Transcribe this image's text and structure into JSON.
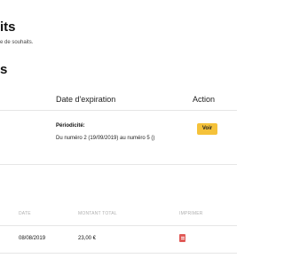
{
  "header": {
    "title": "its",
    "subtitle": "e de souhaits."
  },
  "section": {
    "heading": "s"
  },
  "subscription_table": {
    "col_expiry": "Date d'expiration",
    "col_action": "Action",
    "row": {
      "periodicity_label": "Périodicité:",
      "periodicity_range": "Du numéro 2 (19/09/2019) au numéro 5 ()",
      "action_label": "Voir"
    }
  },
  "orders_table": {
    "col_date": "DATE",
    "col_amount": "MONTANT TOTAL",
    "col_print": "IMPRIMER",
    "rows": [
      {
        "date": "08/08/2019",
        "amount": "23,00 €",
        "print_icon": "pdf-icon"
      }
    ]
  },
  "colors": {
    "accent_button": "#f5c23a",
    "pdf_icon": "#e05a57",
    "divider": "#e6e6e6",
    "muted_header": "#b0b0b0"
  }
}
